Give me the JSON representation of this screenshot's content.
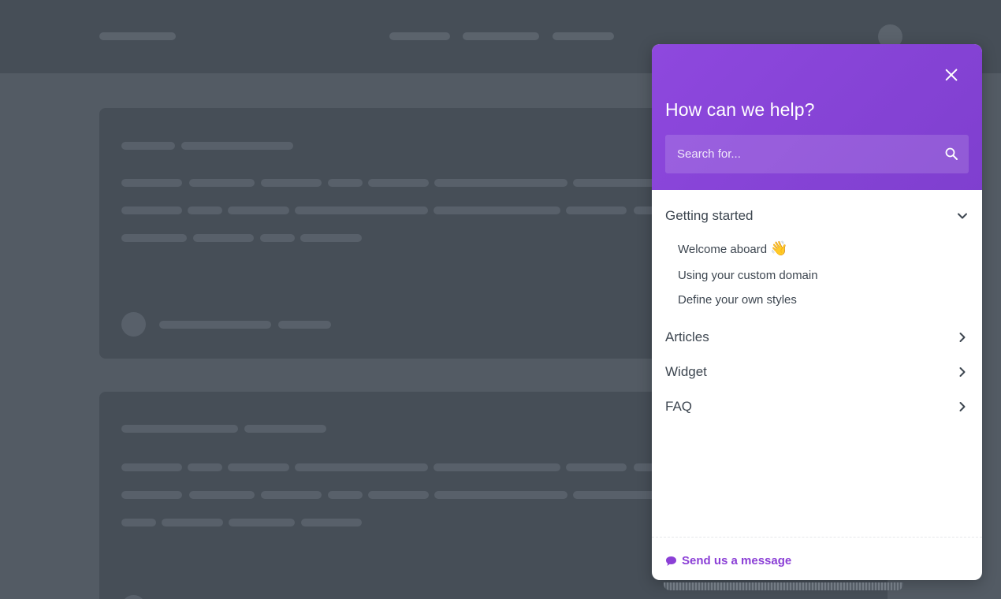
{
  "widget": {
    "title": "How can we help?",
    "search": {
      "placeholder": "Search for..."
    },
    "sections": [
      {
        "label": "Getting started",
        "expanded": true,
        "articles": [
          {
            "label": "Welcome aboard",
            "emoji": "👋"
          },
          {
            "label": "Using your custom domain"
          },
          {
            "label": "Define your own styles"
          }
        ]
      },
      {
        "label": "Articles",
        "expanded": false
      },
      {
        "label": "Widget",
        "expanded": false
      },
      {
        "label": "FAQ",
        "expanded": false
      }
    ],
    "footer": {
      "send_message_label": "Send us a message"
    }
  },
  "icons": {
    "close": "close-icon",
    "search": "search-icon",
    "expanded": "chevron-down-icon",
    "collapsed": "chevron-right-icon",
    "message": "chat-bubble-icon"
  },
  "colors": {
    "header": "#8e48de",
    "accent": "#8b3fd6",
    "backdrop": "#535b64"
  }
}
